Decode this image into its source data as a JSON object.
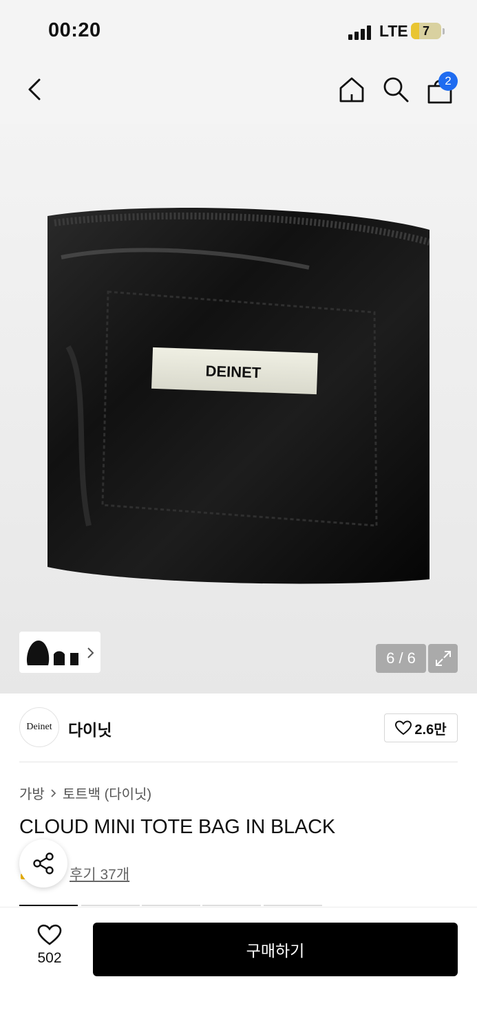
{
  "status_bar": {
    "time": "00:20",
    "network": "LTE",
    "battery": "7"
  },
  "nav": {
    "cart_count": "2",
    "back_icon": "chevron-left-icon",
    "home_icon": "home-icon",
    "search_icon": "search-icon",
    "cart_icon": "shopping-bag-icon"
  },
  "gallery": {
    "counter": "6 / 6",
    "label_text": "DEINET"
  },
  "brand": {
    "logo_text": "Deinet",
    "name": "다이닛",
    "favorite_count": "2.6만"
  },
  "product": {
    "breadcrumb": [
      "가방",
      "토트백 (다이닛)"
    ],
    "title": "CLOUD MINI TOTE BAG IN BLACK",
    "reviews": "후기 37개"
  },
  "bottom_bar": {
    "like_count": "502",
    "buy_label": "구매하기"
  },
  "colors": {
    "accent_blue": "#1f6cf0",
    "buy_button": "#000000"
  }
}
